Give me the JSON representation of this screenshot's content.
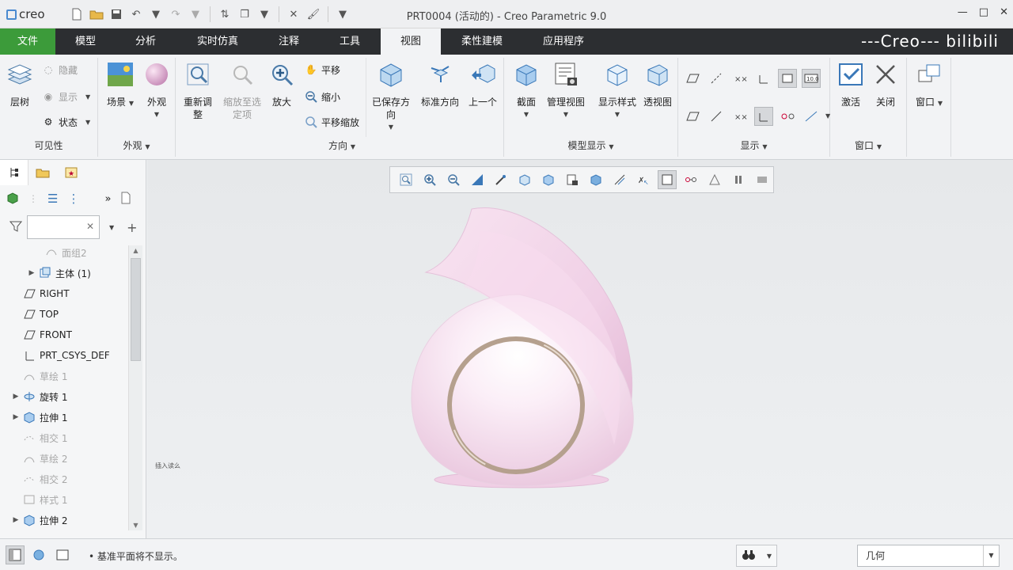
{
  "app": {
    "logo_text": "creo",
    "window_title": "PRT0004 (活动的) - Creo Parametric 9.0",
    "watermark": "---Creo--- bilibili"
  },
  "tabs": [
    "文件",
    "模型",
    "分析",
    "实时仿真",
    "注释",
    "工具",
    "视图",
    "柔性建模",
    "应用程序"
  ],
  "ribbon": {
    "visibility": {
      "label": "可见性",
      "layer_tree": "层树",
      "hide": "隐藏",
      "show": "显示",
      "status": "状态"
    },
    "appearance": {
      "label": "外观",
      "scene": "场景",
      "appearance": "外观"
    },
    "orientation": {
      "label": "方向",
      "refit": "重新调整",
      "zoom_to_selected": "缩放至选定项",
      "zoom_in": "放大",
      "pan": "平移",
      "zoom_out": "缩小",
      "pan_zoom": "平移缩放",
      "saved_orientations": "已保存方向",
      "standard_orientation": "标准方向",
      "previous": "上一个"
    },
    "model_display": {
      "label": "模型显示",
      "section": "截面",
      "manage_views": "管理视图",
      "display_style": "显示样式",
      "perspective": "透视图"
    },
    "show": {
      "label": "显示"
    },
    "window": {
      "label": "窗口",
      "activate": "激活",
      "close": "关闭",
      "windows": "窗口"
    }
  },
  "tree": {
    "filter_placeholder": "",
    "items": [
      {
        "label": "面组2",
        "dim": true,
        "expand": ""
      },
      {
        "label": "主体 (1)",
        "dim": false,
        "expand": "▶"
      },
      {
        "label": "RIGHT",
        "dim": false,
        "expand": ""
      },
      {
        "label": "TOP",
        "dim": false,
        "expand": ""
      },
      {
        "label": "FRONT",
        "dim": false,
        "expand": ""
      },
      {
        "label": "PRT_CSYS_DEF",
        "dim": false,
        "expand": ""
      },
      {
        "label": "草绘 1",
        "dim": true,
        "expand": ""
      },
      {
        "label": "旋转 1",
        "dim": false,
        "expand": "▶"
      },
      {
        "label": "拉伸 1",
        "dim": false,
        "expand": "▶"
      },
      {
        "label": "相交 1",
        "dim": true,
        "expand": ""
      },
      {
        "label": "草绘 2",
        "dim": true,
        "expand": ""
      },
      {
        "label": "相交 2",
        "dim": true,
        "expand": ""
      },
      {
        "label": "样式 1",
        "dim": true,
        "expand": ""
      },
      {
        "label": "拉伸 2",
        "dim": false,
        "expand": "▶"
      }
    ]
  },
  "viewport": {
    "tiny_label": "插入读么"
  },
  "status": {
    "message": "基准平面将不显示。",
    "selection_filter": "几何"
  },
  "colors": {
    "file_tab": "#3c9b3a",
    "tab_bar": "#2c2e31",
    "model": "#f2d6ea",
    "ring": "#b5a08e"
  }
}
